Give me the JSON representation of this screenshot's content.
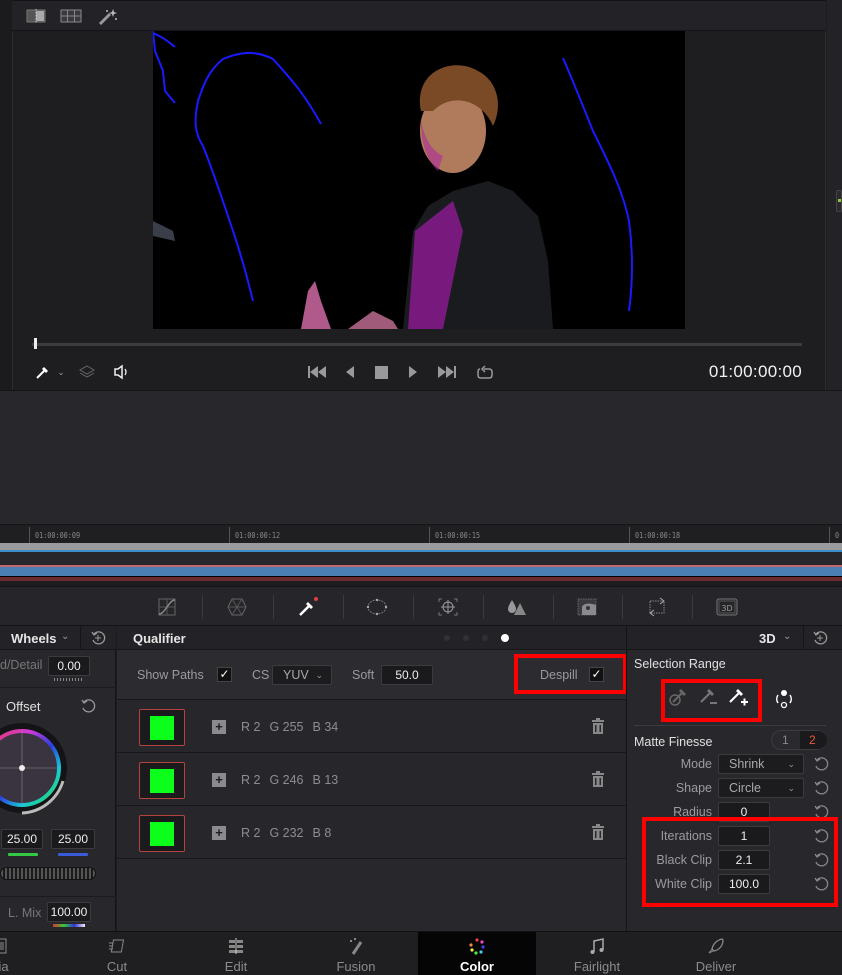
{
  "viewer": {
    "toolbar_icons": [
      "split-view-icon",
      "grid-view-icon",
      "magic-wand-icon"
    ],
    "timecode": "01:00:00:00",
    "playhead_fraction": 0.0,
    "transport": {
      "tool": "qualifier-picker",
      "buttons": [
        "skip-to-start",
        "step-back",
        "stop",
        "play",
        "skip-to-end",
        "loop"
      ]
    }
  },
  "timeline": {
    "ticks": [
      "01:00:00:09",
      "01:00:00:12",
      "01:00:00:15",
      "01:00:00:18",
      "0"
    ]
  },
  "palette": {
    "tools": [
      "curves",
      "color-warper",
      "qualifier",
      "window",
      "tracker",
      "blur",
      "key",
      "sizing",
      "3d"
    ],
    "active": "qualifier"
  },
  "wheels_panel": {
    "title": "Wheels",
    "detail_label": "d/Detail",
    "detail_value": "0.00",
    "offset_label": "Offset",
    "green_value": "25.00",
    "blue_value": "25.00",
    "lmix_label": "L. Mix",
    "lmix_value": "100.00"
  },
  "qualifier": {
    "title": "Qualifier",
    "page_dots": 4,
    "active_dot": 4,
    "show_paths_label": "Show Paths",
    "show_paths_checked": "✓",
    "cs_label": "CS",
    "cs_value": "YUV",
    "soft_label": "Soft",
    "soft_value": "50.0",
    "despill_label": "Despill",
    "despill_checked": "✓",
    "samples": [
      {
        "color": "#0bff1b",
        "r": "R 2",
        "g": "G 255",
        "b": "B 34"
      },
      {
        "color": "#0bff1b",
        "r": "R 2",
        "g": "G 246",
        "b": "B 13"
      },
      {
        "color": "#0bff1b",
        "r": "R 2",
        "g": "G 232",
        "b": "B 8"
      }
    ]
  },
  "right_panel": {
    "mode_dropdown": "3D",
    "selection_range_label": "Selection Range",
    "matte_finesse_label": "Matte Finesse",
    "matte_tabs": [
      "1",
      "2"
    ],
    "matte_active_tab": "2",
    "mode_label": "Mode",
    "mode_value": "Shrink",
    "shape_label": "Shape",
    "shape_value": "Circle",
    "radius_label": "Radius",
    "radius_value": "0",
    "iterations_label": "Iterations",
    "iterations_value": "1",
    "black_clip_label": "Black Clip",
    "black_clip_value": "2.1",
    "white_clip_label": "White Clip",
    "white_clip_value": "100.0"
  },
  "pages": [
    {
      "label": "dia",
      "icon": "media-icon"
    },
    {
      "label": "Cut",
      "icon": "cut-icon"
    },
    {
      "label": "Edit",
      "icon": "edit-icon"
    },
    {
      "label": "Fusion",
      "icon": "fusion-icon"
    },
    {
      "label": "Color",
      "icon": "color-icon",
      "active": true
    },
    {
      "label": "Fairlight",
      "icon": "fairlight-icon"
    },
    {
      "label": "Deliver",
      "icon": "deliver-icon"
    }
  ],
  "colors": {
    "highlight_red": "#ff0000",
    "swatch_green": "#0bff1b",
    "path_blue": "#1a1aff"
  }
}
